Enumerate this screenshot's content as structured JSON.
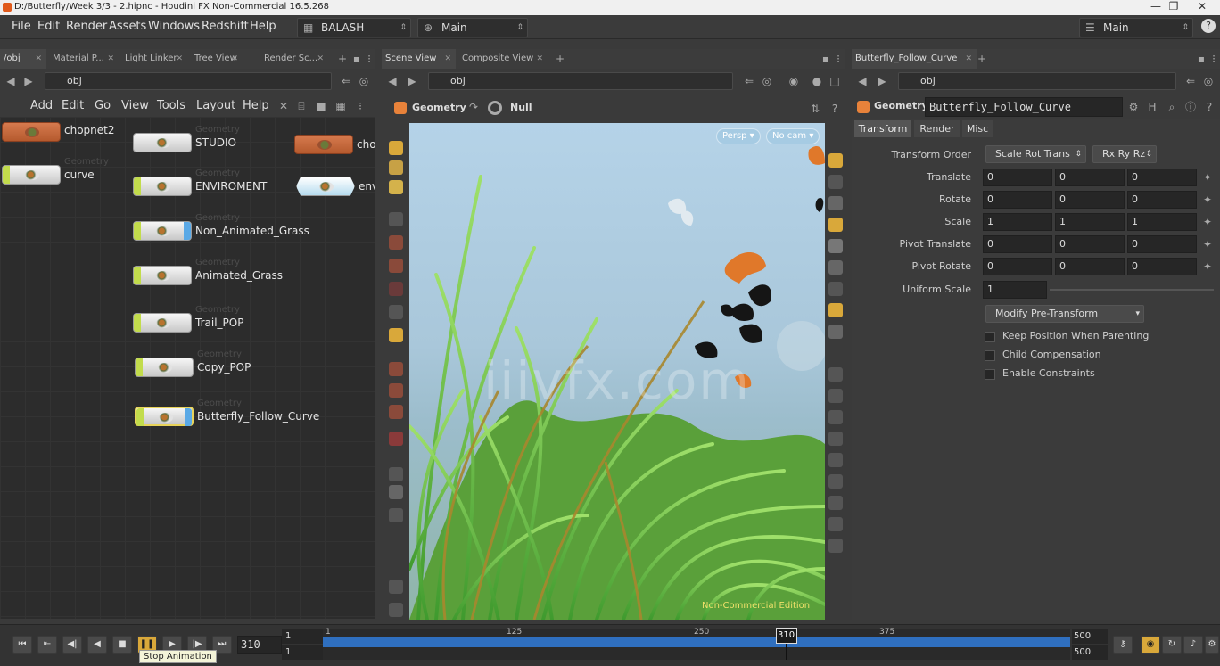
{
  "window": {
    "title": "D:/Butterfly/Week 3/3 - 2.hipnc - Houdini FX Non-Commercial 16.5.268",
    "controls": [
      "—",
      "❐",
      "✕"
    ]
  },
  "menubar": {
    "items": [
      "File",
      "Edit",
      "Render",
      "Assets",
      "Windows",
      "Redshift",
      "Help"
    ],
    "desktop": "BALASH",
    "context": "Main",
    "right_desktop": "Main"
  },
  "left_pane": {
    "tabs": [
      "/obj",
      "Material P...",
      "Light Linker",
      "Tree View",
      "Render Sc..."
    ],
    "path": "obj",
    "menu": [
      "Add",
      "Edit",
      "Go",
      "View",
      "Tools",
      "Layout",
      "Help"
    ],
    "nodes": [
      {
        "name": "chopnet2",
        "type": ""
      },
      {
        "name": "curve",
        "type": "Geometry"
      },
      {
        "name": "STUDIO",
        "type": "Geometry"
      },
      {
        "name": "ENVIROMENT",
        "type": "Geometry"
      },
      {
        "name": "Non_Animated_Grass",
        "type": "Geometry"
      },
      {
        "name": "Animated_Grass",
        "type": "Geometry"
      },
      {
        "name": "Trail_POP",
        "type": "Geometry"
      },
      {
        "name": "Copy_POP",
        "type": "Geometry"
      },
      {
        "name": "Butterfly_Follow_Curve",
        "type": "Geometry"
      },
      {
        "name": "chop",
        "type": ""
      },
      {
        "name": "env",
        "type": ""
      }
    ]
  },
  "center_pane": {
    "tabs": [
      "Scene View",
      "Composite View"
    ],
    "path": "obj",
    "context": "Geometry",
    "state": "Null",
    "camera_view": "Persp",
    "camera": "No cam",
    "watermark": "iiivfx.com",
    "edition": "Non-Commercial Edition"
  },
  "right_pane": {
    "tab": "Butterfly_Follow_Curve",
    "path": "obj",
    "op_type": "Geometry",
    "op_name": "Butterfly_Follow_Curve",
    "subtabs": [
      "Transform",
      "Render",
      "Misc"
    ],
    "transform_order": "Scale Rot Trans",
    "rot_order": "Rx Ry Rz",
    "rows": [
      {
        "label": "Translate",
        "v": [
          "0",
          "0",
          "0"
        ]
      },
      {
        "label": "Rotate",
        "v": [
          "0",
          "0",
          "0"
        ]
      },
      {
        "label": "Scale",
        "v": [
          "1",
          "1",
          "1"
        ]
      },
      {
        "label": "Pivot Translate",
        "v": [
          "0",
          "0",
          "0"
        ]
      },
      {
        "label": "Pivot Rotate",
        "v": [
          "0",
          "0",
          "0"
        ]
      }
    ],
    "transform_order_label": "Transform Order",
    "uniform_scale_label": "Uniform Scale",
    "uniform_scale": "1",
    "modify_btn": "Modify Pre-Transform",
    "checks": [
      "Keep Position When Parenting",
      "Child Compensation",
      "Enable Constraints"
    ]
  },
  "timeline": {
    "current_frame": "310",
    "start": "1",
    "start2": "1",
    "end": "500",
    "end2": "500",
    "ticks": [
      "1",
      "125",
      "250",
      "310",
      "375"
    ],
    "tooltip": "Stop Animation",
    "playhead_fraction": 0.62
  }
}
